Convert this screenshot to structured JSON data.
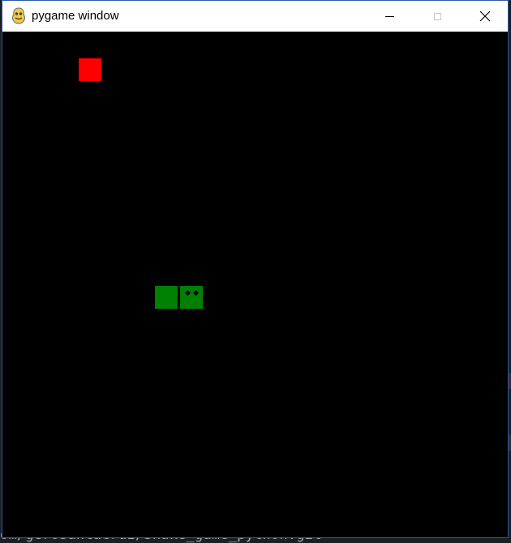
{
  "window": {
    "title": "pygame window",
    "app_icon": "pygame-snake-icon",
    "controls": {
      "minimize_icon": "minimize-icon",
      "maximize_icon": "maximize-icon",
      "close_icon": "close-icon"
    }
  },
  "game": {
    "background_color": "#000000",
    "food": {
      "color": "#ff0000"
    },
    "snake": {
      "color": "#008000",
      "segments": [
        "body",
        "head"
      ],
      "direction": "right"
    }
  },
  "background": {
    "terminal_text": "om/gerosantacruz/Snake_game_python.git"
  }
}
